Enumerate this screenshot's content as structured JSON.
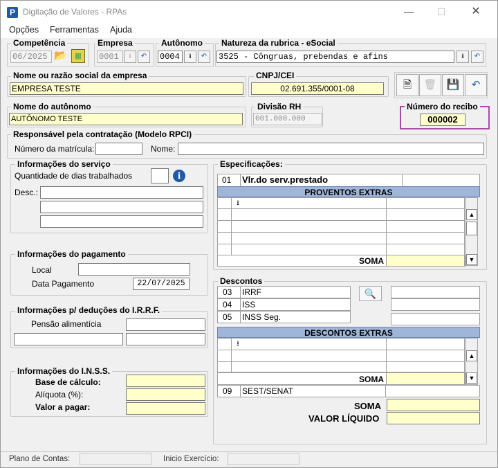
{
  "window": {
    "title": "Digitação de Valores - RPAs",
    "app_icon": "P"
  },
  "menu": [
    "Opções",
    "Ferramentas",
    "Ajuda"
  ],
  "competencia": {
    "label": "Competência",
    "value": "06/2025"
  },
  "empresa": {
    "label": "Empresa",
    "value": "0001"
  },
  "autonomo": {
    "label": "Autônomo",
    "value": "0004"
  },
  "natureza": {
    "label": "Natureza da rubrica - eSocial",
    "value": "3525 - Côngruas, prebendas e afins"
  },
  "razao": {
    "label": "Nome ou razão social da empresa",
    "value": "EMPRESA TESTE"
  },
  "cnpj": {
    "label": "CNPJ/CEI",
    "value": "02.691.355/0001-08"
  },
  "nome_autonomo": {
    "label": "Nome do autônomo",
    "value": "AUTÔNOMO TESTE"
  },
  "divisao": {
    "label": "Divisão RH",
    "value": "001.000.000"
  },
  "recibo": {
    "label": "Número do recibo",
    "value": "000002"
  },
  "responsavel": {
    "title": "Responsável pela contratação (Modelo RPCI)",
    "matricula_label": "Número da matrícula:",
    "nome_label": "Nome:"
  },
  "servico": {
    "title": "Informações do serviço",
    "dias_label": "Quantidade de dias trabalhados",
    "desc_label": "Desc.:"
  },
  "pagamento": {
    "title": "Informações do pagamento",
    "local_label": "Local",
    "data_label": "Data Pagamento",
    "data_value": "22/07/2025"
  },
  "irrf": {
    "title": "Informações p/ deduções do I.R.R.F.",
    "pensao_label": "Pensão alimentícia"
  },
  "inss": {
    "title": "Informações do I.N.S.S.",
    "base_label": "Base de cálculo:",
    "aliquota_label": "Alíquota (%):",
    "valor_label": "Valor a pagar:"
  },
  "especificacoes": {
    "title": "Especificações:",
    "code": "01",
    "desc": "Vlr.do serv.prestado",
    "proventos_header": "PROVENTOS EXTRAS",
    "soma_label": "SOMA"
  },
  "descontos": {
    "title": "Descontos",
    "rows": [
      {
        "code": "03",
        "desc": "IRRF"
      },
      {
        "code": "04",
        "desc": "ISS"
      },
      {
        "code": "05",
        "desc": "INSS Seg."
      }
    ],
    "extras_header": "DESCONTOS EXTRAS",
    "soma_label": "SOMA",
    "sest_code": "09",
    "sest_desc": "SEST/SENAT",
    "total_soma_label": "SOMA",
    "liquido_label": "VALOR LÍQUIDO"
  },
  "status": {
    "plano_label": "Plano de Contas:",
    "exercicio_label": "Inicio Exercício:"
  },
  "colors": {
    "accent": "#1e5aa8",
    "highlight_border": "#a64ca6",
    "yellow_field": "#ffffcc",
    "table_header": "#9fb6d8"
  },
  "icons": [
    "app-icon",
    "folder-open-icon",
    "calendar-icon",
    "dropdown-icon",
    "undo-icon",
    "new-document-icon",
    "delete-icon",
    "save-icon",
    "info-icon",
    "search-icon"
  ]
}
